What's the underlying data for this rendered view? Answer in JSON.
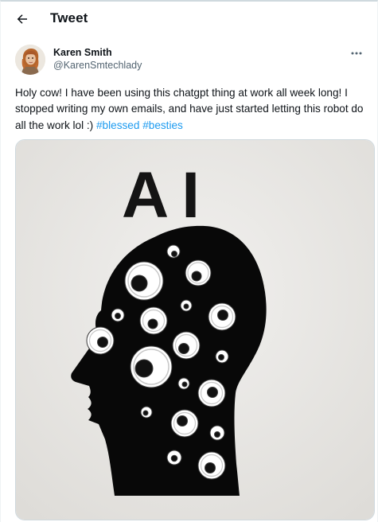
{
  "header": {
    "title": "Tweet",
    "back_icon": "arrow-left-icon"
  },
  "author": {
    "display_name": "Karen Smith",
    "handle": "@KarenSmtechlady",
    "more_icon": "more-horizontal-icon"
  },
  "tweet": {
    "text": "Holy cow! I have been using this chatgpt thing at work all week long! I stopped writing my own emails, and have just started letting this robot do all the work lol :)",
    "hashtags": [
      "#blessed",
      "#besties"
    ]
  },
  "media": {
    "image_text": "AI",
    "description_icon": "googly-eye-head-image"
  },
  "colors": {
    "link": "#1d9bf0",
    "text": "#0f1419",
    "secondary_text": "#536471",
    "border": "#cfd9de"
  }
}
